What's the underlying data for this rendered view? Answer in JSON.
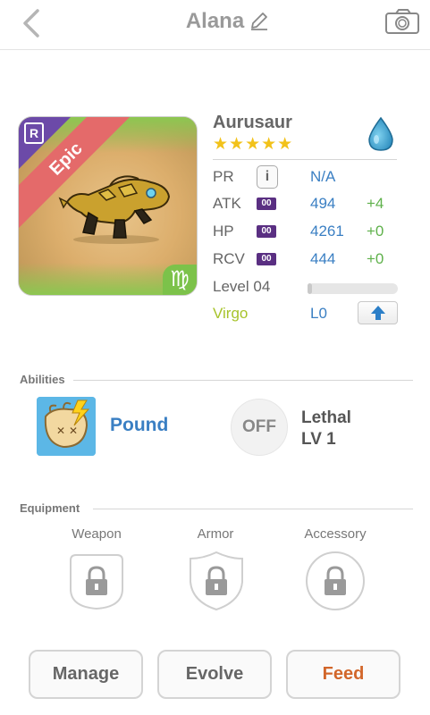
{
  "header": {
    "title": "Alana",
    "back_icon": "chevron-left-icon",
    "edit_icon": "pencil-icon",
    "camera_icon": "camera-icon"
  },
  "monster": {
    "name": "Aurusaur",
    "rarity": "Epic",
    "rarity_badge": "R",
    "star_count": 5,
    "stars": "★★★★★",
    "element_icon": "water-drop-icon",
    "zodiac_symbol": "♍",
    "stats": [
      {
        "label": "PR",
        "value": "N/A",
        "bonus": ""
      },
      {
        "label": "ATK",
        "tag": "00",
        "value": "494",
        "bonus": "+4"
      },
      {
        "label": "HP",
        "tag": "00",
        "value": "4261",
        "bonus": "+0"
      },
      {
        "label": "RCV",
        "tag": "00",
        "value": "444",
        "bonus": "+0"
      }
    ],
    "level_label": "Level 04",
    "level_progress": 0.05,
    "sign_label": "Virgo",
    "sign_level": "L0"
  },
  "abilities": {
    "heading": "Abilities",
    "active": {
      "name": "Pound"
    },
    "passive": {
      "state": "OFF",
      "name": "Lethal",
      "level": "LV 1"
    }
  },
  "equipment": {
    "heading": "Equipment",
    "slots": [
      {
        "label": "Weapon"
      },
      {
        "label": "Armor"
      },
      {
        "label": "Accessory"
      }
    ]
  },
  "actions": {
    "manage": "Manage",
    "evolve": "Evolve",
    "feed": "Feed"
  },
  "colors": {
    "accent_blue": "#3a7fc3",
    "bonus_green": "#5fb14b",
    "feed_orange": "#d2662a",
    "epic_ribbon": "#e46a6a",
    "star_gold": "#f2c21a"
  }
}
